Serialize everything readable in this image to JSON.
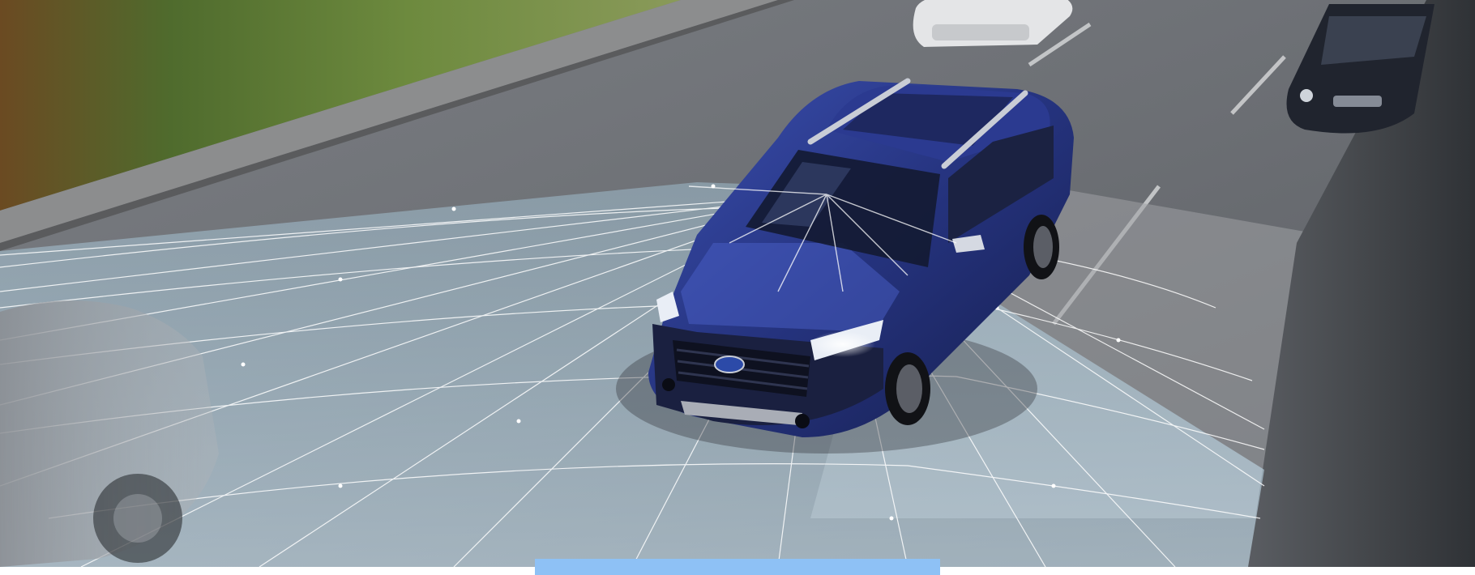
{
  "scene": {
    "subject": "blue-suv",
    "overlay": "sensor-grid",
    "colors": {
      "road": "#6e7177",
      "road_light": "#a7a9ad",
      "grass": "#5c7a35",
      "suv_body": "#2a3a8c",
      "suv_dark": "#1a2358",
      "grid_fill": "#9fd3f0",
      "grid_line": "#ffffff",
      "accent_bar": "#8ec1f5"
    }
  }
}
